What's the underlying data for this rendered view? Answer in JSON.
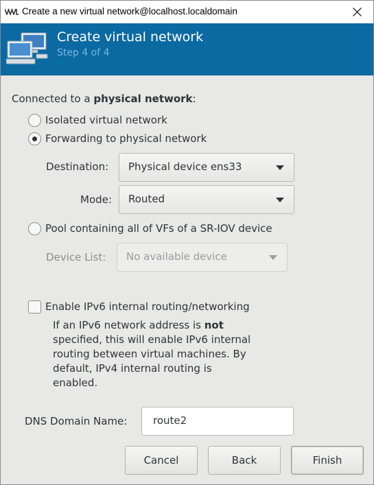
{
  "window": {
    "title": "Create a new virtual network@localhost.localdomain",
    "close_glyph": "×"
  },
  "banner": {
    "title": "Create virtual network",
    "step": "Step 4 of 4",
    "icon": "network-computers-icon",
    "background": "#0b6aa2"
  },
  "connection": {
    "prefix": "Connected to a ",
    "bold": "physical network",
    "suffix": ":"
  },
  "options": {
    "isolated": {
      "label": "Isolated virtual network",
      "checked": false
    },
    "forwarding": {
      "label": "Forwarding to physical network",
      "checked": true
    },
    "pool": {
      "label": "Pool containing all of VFs of a SR-IOV device",
      "checked": false
    }
  },
  "destination": {
    "label": "Destination:",
    "value": "Physical device ens33"
  },
  "mode": {
    "label": "Mode:",
    "value": "Routed"
  },
  "device_list": {
    "label": "Device List:",
    "value": "No available device"
  },
  "ipv6": {
    "label": "Enable IPv6 internal routing/networking",
    "checked": false,
    "help_before": "If an IPv6 network address is ",
    "help_bold": "not",
    "help_after": " specified, this will enable IPv6 internal routing between virtual machines.  By default, IPv4 internal routing is enabled."
  },
  "dns": {
    "label": "DNS Domain Name:",
    "value": "route2"
  },
  "buttons": {
    "cancel": "Cancel",
    "back": "Back",
    "finish": "Finish"
  }
}
